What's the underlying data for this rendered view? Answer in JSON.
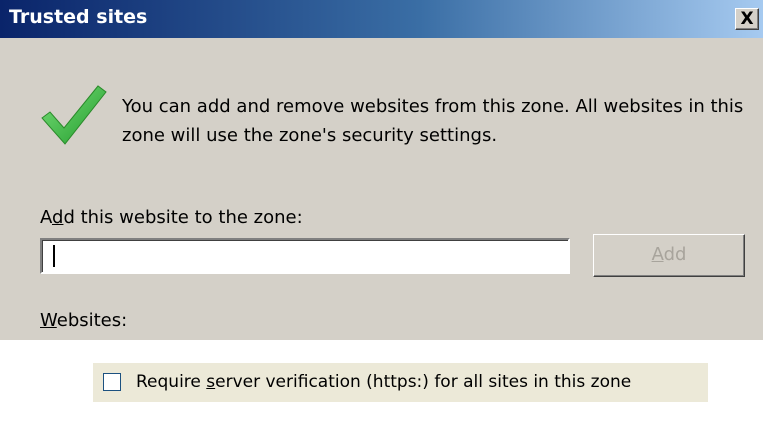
{
  "window": {
    "title": "Trusted sites",
    "close_icon": "close-icon",
    "close_glyph": "X"
  },
  "info": {
    "icon": "green-checkmark-icon",
    "text": "You can add and remove websites from this zone. All websites in this zone will use the zone's security settings."
  },
  "add_site": {
    "label_pre": "A",
    "label_mnemonic": "d",
    "label_post": "d this website to the zone:",
    "input_value": "",
    "button_mnemonic": "A",
    "button_rest": "dd",
    "button_enabled": false
  },
  "websites": {
    "label_mnemonic": "W",
    "label_rest": "ebsites:"
  },
  "verification": {
    "checked": false,
    "label_pre": "Require ",
    "label_mnemonic": "s",
    "label_post": "erver verification (https:) for all sites in this zone"
  },
  "colors": {
    "dialog_face": "#d4d0c8",
    "title_gradient_start": "#0a246a",
    "title_gradient_end": "#a6caf0",
    "check_green": "#3cb83c",
    "disabled_text": "#a8a49c"
  }
}
